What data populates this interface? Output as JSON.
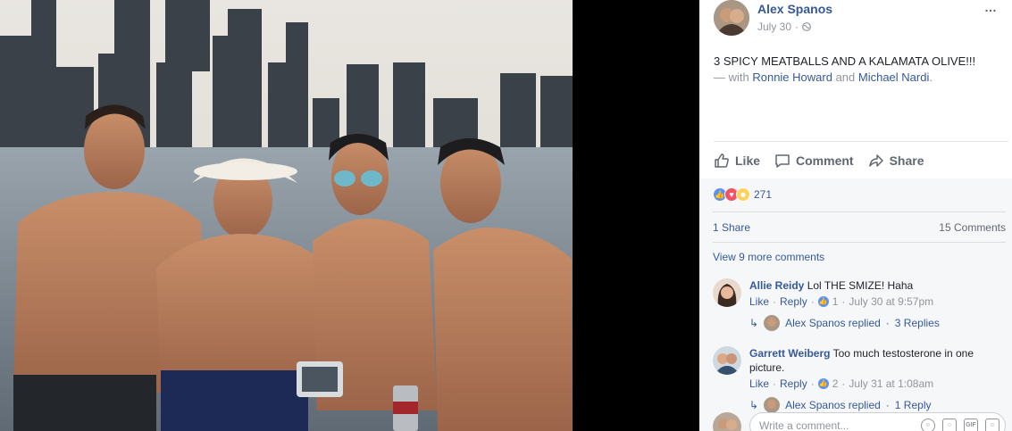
{
  "post": {
    "author": "Alex Spanos",
    "date": "July 30",
    "separator": "·",
    "more_icon": "…",
    "text": "3 SPICY MEATBALLS AND A KALAMATA OLIVE!!!",
    "with_prefix": "— with ",
    "with_person1": "Ronnie Howard",
    "with_and": " and ",
    "with_person2": "Michael Nardi",
    "with_suffix": "."
  },
  "actions": {
    "like": "Like",
    "comment": "Comment",
    "share": "Share"
  },
  "feedback": {
    "reaction_count": "271",
    "shares": "1 Share",
    "comments_count": "15 Comments",
    "view_more": "View 9 more comments"
  },
  "comments": [
    {
      "name": "Allie Reidy",
      "text": "Lol THE SMIZE! Haha",
      "like": "Like",
      "reply": "Reply",
      "likes": "1",
      "time": "July 30 at 9:57pm",
      "replies_author": "Alex Spanos replied",
      "replies_count": "3 Replies"
    },
    {
      "name": "Garrett Weiberg",
      "text": "Too much testosterone in one picture.",
      "like": "Like",
      "reply": "Reply",
      "likes": "2",
      "time": "July 31 at 1:08am",
      "replies_author": "Alex Spanos replied",
      "replies_count": "1 Reply"
    }
  ],
  "composer": {
    "placeholder": "Write a comment..."
  },
  "colors": {
    "link": "#365899",
    "muted": "#90949c",
    "like_blue": "#5890ff",
    "love_red": "#f25268",
    "haha_yellow": "#fcd25a"
  },
  "icons": [
    "globe-icon",
    "more-icon",
    "like-icon",
    "comment-icon",
    "share-icon",
    "reply-arrow-icon",
    "emoji-icon",
    "camera-icon",
    "gif-icon",
    "sticker-icon"
  ]
}
